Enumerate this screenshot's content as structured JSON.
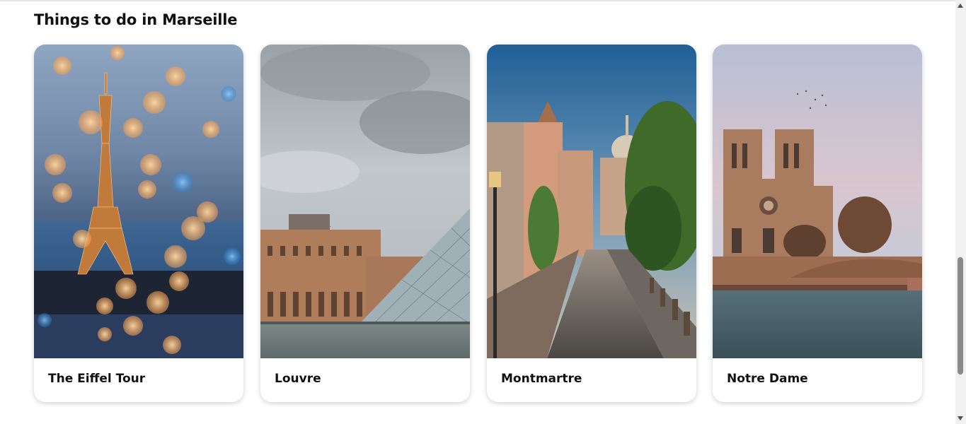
{
  "section": {
    "title": "Things to do in Marseille"
  },
  "cards": [
    {
      "label": "The Eiffel Tour",
      "image": "eiffel-tower-photo"
    },
    {
      "label": "Louvre",
      "image": "louvre-photo"
    },
    {
      "label": "Montmartre",
      "image": "montmartre-photo"
    },
    {
      "label": "Notre Dame",
      "image": "notre-dame-photo"
    }
  ],
  "scrollbar": {
    "position_fraction": 0.72
  }
}
